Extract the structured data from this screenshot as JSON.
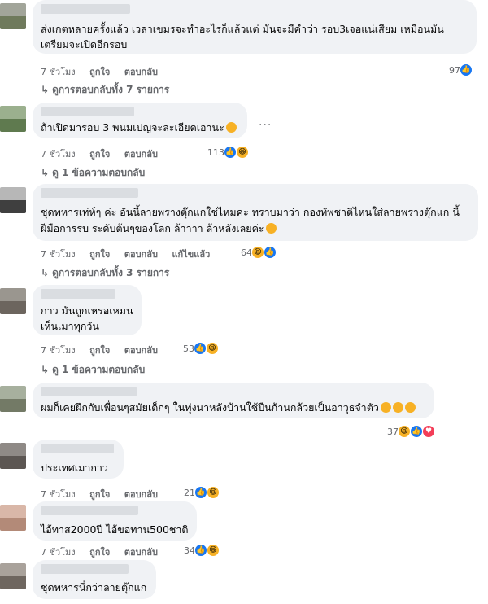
{
  "actions": {
    "time": "7 ชั่วโมง",
    "like": "ถูกใจ",
    "reply": "ตอบกลับ",
    "edited": "แก้ไขแล้ว"
  },
  "comments": [
    {
      "lines": [
        "ส่งเกตหลายครั้งแล้ว เวลาเขมรจะทำอะไรก็แล้วแต่ มันจะมีคำว่า รอบ3เจอแน่เสียม เหมือนมัน",
        "เตรียมจะเปิดอีกรอบ"
      ],
      "count": "97",
      "replies": "ดูการตอบกลับทั้ง 7 รายการ"
    },
    {
      "lines": [
        "ถ้าเปิดมารอบ 3 พนมเปญจะละเอียดเอานะ"
      ],
      "count": "113",
      "replies": "ดู 1 ข้อความตอบกลับ"
    },
    {
      "lines": [
        "ชุดทหารเท่ห์ๆ ค่ะ อันนี้ลายพรางตุ๊กแกใช่ไหมค่ะ ทราบมาว่า กองทัพชาติไหนใส่ลายพรางตุ๊กแก นี้",
        "ฝีมือการรบ ระดับต้นๆของโลก ล้าาาา ล้าหลังเลยค่ะ"
      ],
      "count": "64",
      "replies": "ดูการตอบกลับทั้ง 3 รายการ"
    },
    {
      "lines": [
        "กาว มันถูกเหรอเหมน",
        "เห็นเมาทุกวัน"
      ],
      "count": "53",
      "replies": "ดู 1 ข้อความตอบกลับ"
    },
    {
      "lines": [
        "ผมก็เคยฝึกกับเพื่อนๆสมัยเด็กๆ ในทุ่งนาหลังบ้านใช้ปืนก้านกล้วยเป็นอาวุธจำตัว"
      ],
      "count": "37",
      "replies": ""
    },
    {
      "lines": [
        "ประเทศเมากาว"
      ],
      "count": "21",
      "replies": ""
    },
    {
      "lines": [
        "ไอ้ทาส2000ปี ไอ้ขอทาน500ชาติ"
      ],
      "count": "34",
      "replies": ""
    },
    {
      "lines": [
        "ชุดทหารนี่กว่าลายตุ๊กแก"
      ],
      "count": "",
      "replies": ""
    }
  ],
  "icons": {
    "like": "like-reaction-icon",
    "haha": "haha-reaction-icon",
    "love": "love-reaction-icon",
    "more": "more-options-icon"
  },
  "colors": {
    "bubble": "#f0f2f5",
    "secondary_text": "#65676b",
    "like_blue": "#1877f2",
    "haha_yellow": "#f7b125",
    "love_red": "#f33e58"
  }
}
